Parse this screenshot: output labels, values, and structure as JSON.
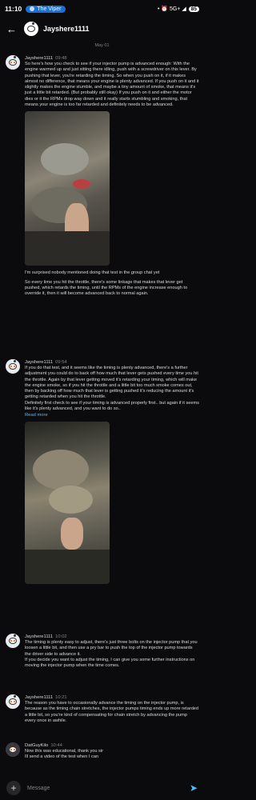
{
  "status_bar": {
    "time": "11:10",
    "app_pill": "The Viper",
    "indicators": "• ⏰ 5G+ ◢",
    "battery": "85"
  },
  "header": {
    "back_icon": "arrow-left-icon",
    "title": "Jayshere1111"
  },
  "day_divider": "May 01",
  "messages": [
    {
      "author": "Jayshere1111",
      "time": "09:48",
      "text": "So here's how you check to see if your injector pump is advanced enough:   With the engine warmed up and just sitting there idling, push with a screwdriver on this lever. By pushing that lever, you're retarding the timing. So when you push on it, if it makes almost no difference, that means your engine is plenty advanced. If you push on it and it slightly makes the engine stumble, and maybe a tiny amount of smoke, that means it's just a little bit retarded. (But probably still okay)  If you push on it and either the motor dies or it the RPMs drop way down and it really starts stumbling and smoking, that means your engine is too far retarded and definitely needs to be advanced."
    },
    {
      "text": "I'm surprised nobody mentioned doing that test in the group chat yet"
    },
    {
      "text": "So every time you hit the throttle, there's some linkage that makes that lever get pushed, which retards the timing, until the RPMs of the engine increase enough to override it, then it will become advanced back to normal again."
    },
    {
      "author": "Jayshere1111",
      "time": "09:54",
      "text": "If you do that test, and it seems like the timing is plenty advanced, there's a further adjustment you could do to back off how much that lever gets pushed every time you hit the throttle. Again by that lever getting moved it's retarding your timing, which will make the engine smoke, so if you hit the throttle and a little bit too much smoke comes out, then by backing off how much that lever is getting pushed it's reducing the amount it's getting retarded when you hit the throttle.\nDefinitely first check to see if your timing is advanced properly first.. but again if it seems like it's plenty advanced, and you want to do so..",
      "read_more": "Read more"
    },
    {
      "author": "Jayshere1111",
      "time": "10:02",
      "text": "The timing is plenty easy to adjust, there's just three bolts on the injector pump that you loosen a little bit, and then use a pry bar to push the top of the injector pump towards the driver side to advance it.\nIf you decide you want to adjust the timing, I can give you some further instructions on moving the injector pump when the time comes."
    },
    {
      "author": "Jayshere1111",
      "time": "10:21",
      "text": "The reason you have to occasionally advance the timing on the injector pump, is because as the timing chain stretches, the injector pumps timing ends up more retarded a little bit, so you're kind of compensating for chain stretch by advancing the pump every once in awhile."
    },
    {
      "author": "DatGuyKilo",
      "time": "10:44",
      "text": "Now this was educational, thank you sir\nIll send a video of the test when I can"
    }
  ],
  "composer": {
    "add_icon": "plus-icon",
    "placeholder": "Message",
    "send_icon": "send-icon"
  },
  "colors": {
    "background": "#0b0b0d",
    "text": "#d7dadc",
    "muted": "#818384",
    "link": "#4fbcff",
    "status_pill": "#1d6fd8"
  }
}
